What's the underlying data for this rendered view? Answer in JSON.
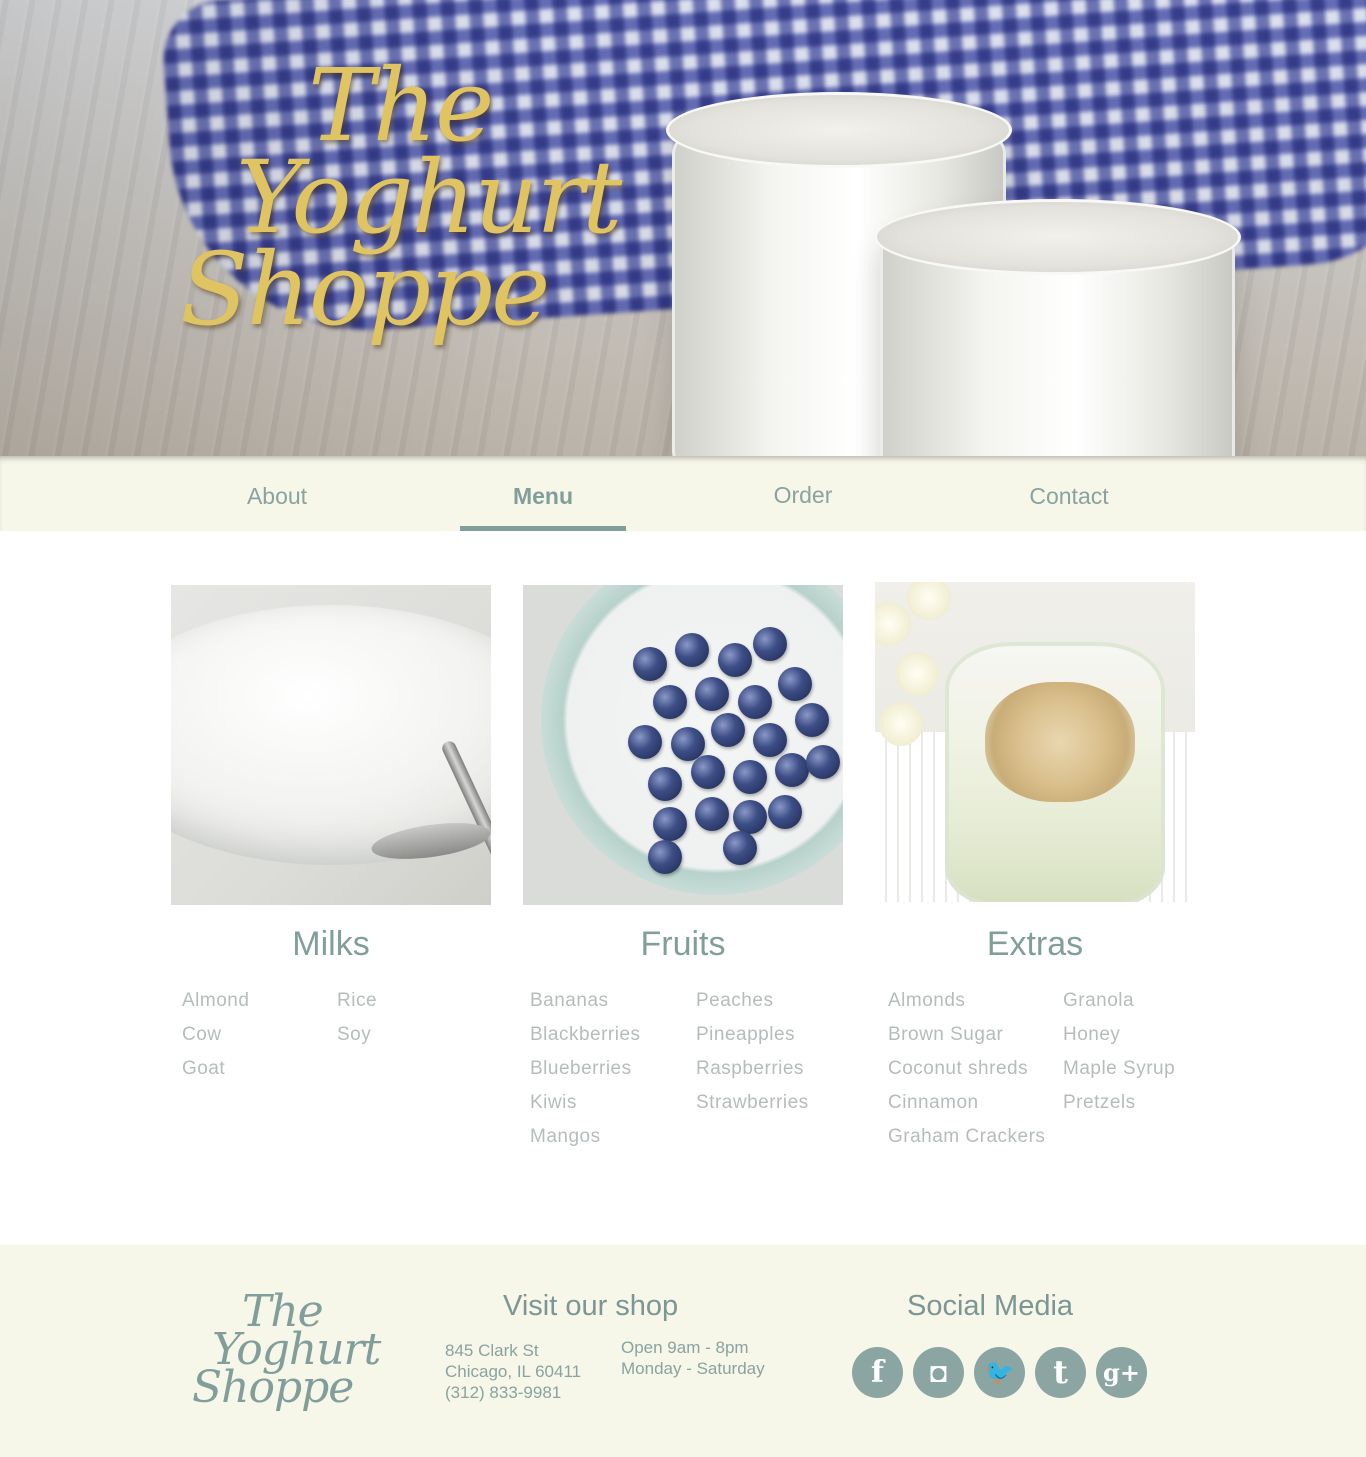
{
  "hero": {
    "title_lines": [
      "The",
      "Yoghurt",
      "Shoppe"
    ]
  },
  "nav": {
    "items": [
      {
        "label": "About",
        "active": false
      },
      {
        "label": "Menu",
        "active": true
      },
      {
        "label": "Order",
        "active": false
      },
      {
        "label": "Contact",
        "active": false
      }
    ]
  },
  "menu": {
    "milks": {
      "title": "Milks",
      "left": [
        "Almond",
        "Cow",
        "Goat"
      ],
      "right": [
        "Rice",
        "Soy"
      ]
    },
    "fruits": {
      "title": "Fruits",
      "left": [
        "Bananas",
        "Blackberries",
        "Blueberries",
        "Kiwis",
        "Mangos"
      ],
      "right": [
        "Peaches",
        "Pineapples",
        "Raspberries",
        "Strawberries"
      ]
    },
    "extras": {
      "title": "Extras",
      "left": [
        "Almonds",
        "Brown Sugar",
        "Coconut shreds",
        "Cinnamon",
        "Graham Crackers"
      ],
      "right": [
        "Granola",
        "Honey",
        "Maple Syrup",
        "Pretzels"
      ]
    }
  },
  "footer": {
    "logo_lines": [
      "The",
      "Yoghurt",
      "Shoppe"
    ],
    "visit_heading": "Visit our shop",
    "address": [
      "845 Clark St",
      "Chicago, IL 60411",
      "(312) 833-9981"
    ],
    "hours": [
      "Open 9am - 8pm",
      "Monday - Saturday"
    ],
    "social_heading": "Social Media",
    "social": [
      {
        "icon": "facebook-icon",
        "glyph": "f"
      },
      {
        "icon": "instagram-icon",
        "glyph": "◘"
      },
      {
        "icon": "twitter-icon",
        "glyph": "🐦"
      },
      {
        "icon": "tumblr-icon",
        "glyph": "t"
      },
      {
        "icon": "google-plus-icon",
        "glyph": "g+"
      }
    ]
  },
  "colors": {
    "accent": "#819e9b",
    "gold": "#e0c462",
    "cream": "#f6f6e9",
    "list_text": "#b5bcbb"
  }
}
